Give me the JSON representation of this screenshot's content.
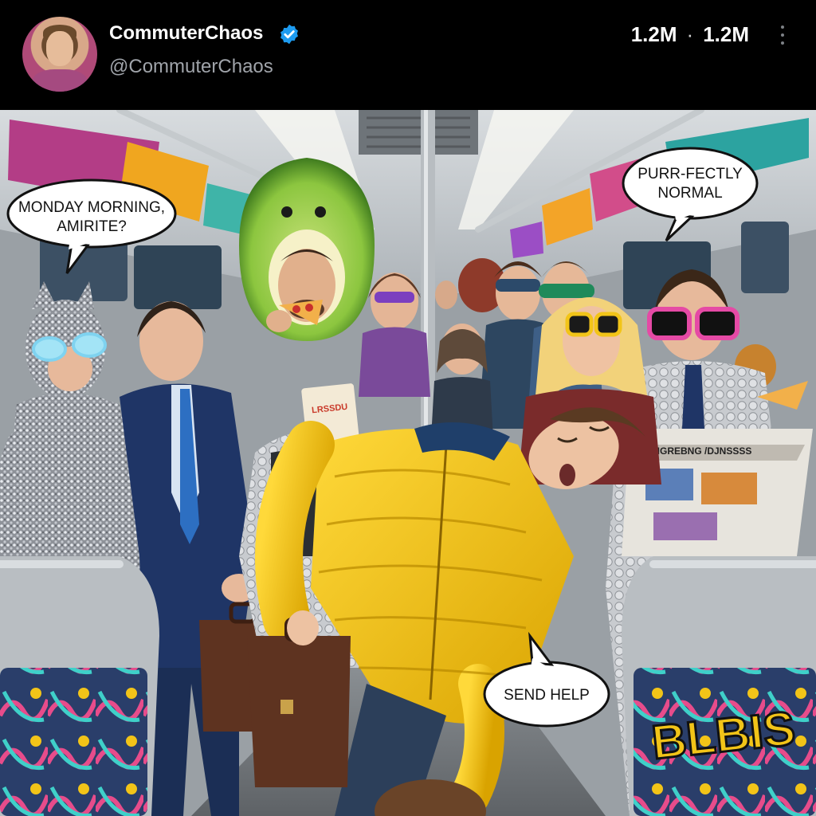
{
  "post": {
    "display_name": "CommuterChaos",
    "handle": "@CommuterChaos",
    "stat_1": "1.2M",
    "separator": "·",
    "stat_2": "1.2M",
    "verified_color": "#1d9bf0"
  },
  "image": {
    "bubbles": [
      {
        "line1": "MONDAY MORNING,",
        "line2": "AMIRITE?"
      },
      {
        "line1": "PURR-FECTLY",
        "line2": "NORMAL"
      },
      {
        "line1": "SEND HELP",
        "line2": ""
      }
    ],
    "newspaper_headline": "EIGREBNG /DJNSSSS",
    "menu_title": "LRSSDU"
  },
  "colors": {
    "header_bg": "#000000",
    "handle": "#a0a4aa",
    "jacket": "#f2c418",
    "avocado": "#8cc63f"
  }
}
